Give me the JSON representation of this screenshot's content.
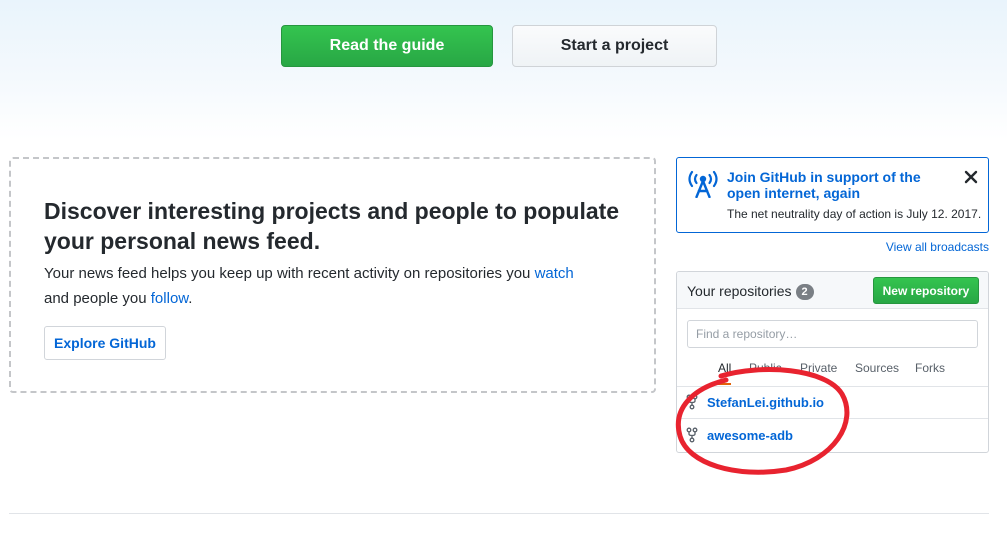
{
  "hero": {
    "read_guide_label": "Read the guide",
    "start_project_label": "Start a project"
  },
  "discover": {
    "title": "Discover interesting projects and people to populate your personal news feed.",
    "text_before_watch": "Your news feed helps you keep up with recent activity on repositories you ",
    "watch_link": "watch",
    "text_between": " and people you ",
    "follow_link": "follow",
    "text_end": ".",
    "explore_label": "Explore GitHub"
  },
  "broadcast": {
    "icon": "broadcast-icon",
    "title": "Join GitHub in support of the open internet, again",
    "subtitle": "The net neutrality day of action is July 12. 2017.",
    "close_icon": "close-icon",
    "view_all_label": "View all broadcasts"
  },
  "repositories": {
    "title": "Your repositories",
    "count": "2",
    "new_repo_label": "New repository",
    "search_placeholder": "Find a repository…",
    "search_value": "",
    "tabs": [
      {
        "label": "All",
        "active": true
      },
      {
        "label": "Public",
        "active": false
      },
      {
        "label": "Private",
        "active": false
      },
      {
        "label": "Sources",
        "active": false
      },
      {
        "label": "Forks",
        "active": false
      }
    ],
    "items": [
      {
        "name": "StefanLei.github.io",
        "icon": "repo-forked-icon"
      },
      {
        "name": "awesome-adb",
        "icon": "repo-forked-icon"
      }
    ]
  },
  "colors": {
    "accent": "#0366d6",
    "primary_button": "#28a745",
    "annotation": "#e8232f",
    "active_tab_underline": "#e36209"
  }
}
